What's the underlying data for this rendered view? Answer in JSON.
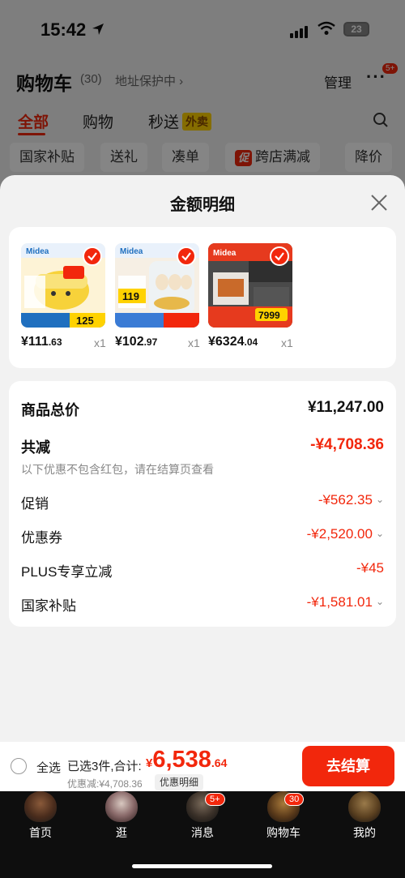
{
  "status_bar": {
    "time": "15:42",
    "battery": "23"
  },
  "cart_header": {
    "title": "购物车",
    "count": "(30)",
    "address_protect": "地址保护中 ›",
    "manage": "管理",
    "more": "···",
    "more_badge": "5+"
  },
  "cart_tabs": {
    "all": "全部",
    "shopping": "购物",
    "flash": "秒送",
    "flash_tag": "外卖"
  },
  "filters": {
    "national_subsidy": "国家补贴",
    "gift": "送礼",
    "combine": "凑单",
    "promo_tag": "促",
    "cross_store": "跨店满减",
    "price_drop": "降价"
  },
  "sheet": {
    "title": "金额明细",
    "products": [
      {
        "price_int": "¥111",
        "price_dec": ".63",
        "qty": "x1",
        "image": "yellow-rice-cooker",
        "brand": "Midea",
        "promo_price": "125"
      },
      {
        "price_int": "¥102",
        "price_dec": ".97",
        "qty": "x1",
        "image": "egg-steamer",
        "brand": "Midea",
        "promo_price": "119"
      },
      {
        "price_int": "¥6324",
        "price_dec": ".04",
        "qty": "x1",
        "image": "kitchen-appliance-set",
        "brand": "Midea",
        "promo_price": "7999"
      }
    ],
    "details": {
      "subtotal_label": "商品总价",
      "subtotal_value": "¥11,247.00",
      "total_discount_label": "共减",
      "total_discount_value": "-¥4,708.36",
      "discount_note": "以下优惠不包含红包，请在结算页查看",
      "promotion_label": "促销",
      "promotion_value": "-¥562.35",
      "coupon_label": "优惠券",
      "coupon_value": "-¥2,520.00",
      "plus_label": "PLUS专享立减",
      "plus_value": "-¥45",
      "subsidy_label": "国家补贴",
      "subsidy_value": "-¥1,581.01"
    }
  },
  "checkout": {
    "select_all": "全选",
    "selected_summary": "已选3件,合计:",
    "total_symbol": "¥",
    "total_int": "6,538",
    "total_dec": ".64",
    "discount_note": "优惠减:¥4,708.36",
    "detail_button": "优惠明细",
    "checkout_button": "去结算"
  },
  "tabbar": {
    "items": [
      {
        "label": "首页"
      },
      {
        "label": "逛"
      },
      {
        "label": "消息",
        "badge": "5+"
      },
      {
        "label": "购物车",
        "badge": "30"
      },
      {
        "label": "我的"
      }
    ]
  },
  "colors": {
    "accent": "#f2270c",
    "background": "#f2f2f2",
    "tabbar": "#0e0e0e"
  }
}
